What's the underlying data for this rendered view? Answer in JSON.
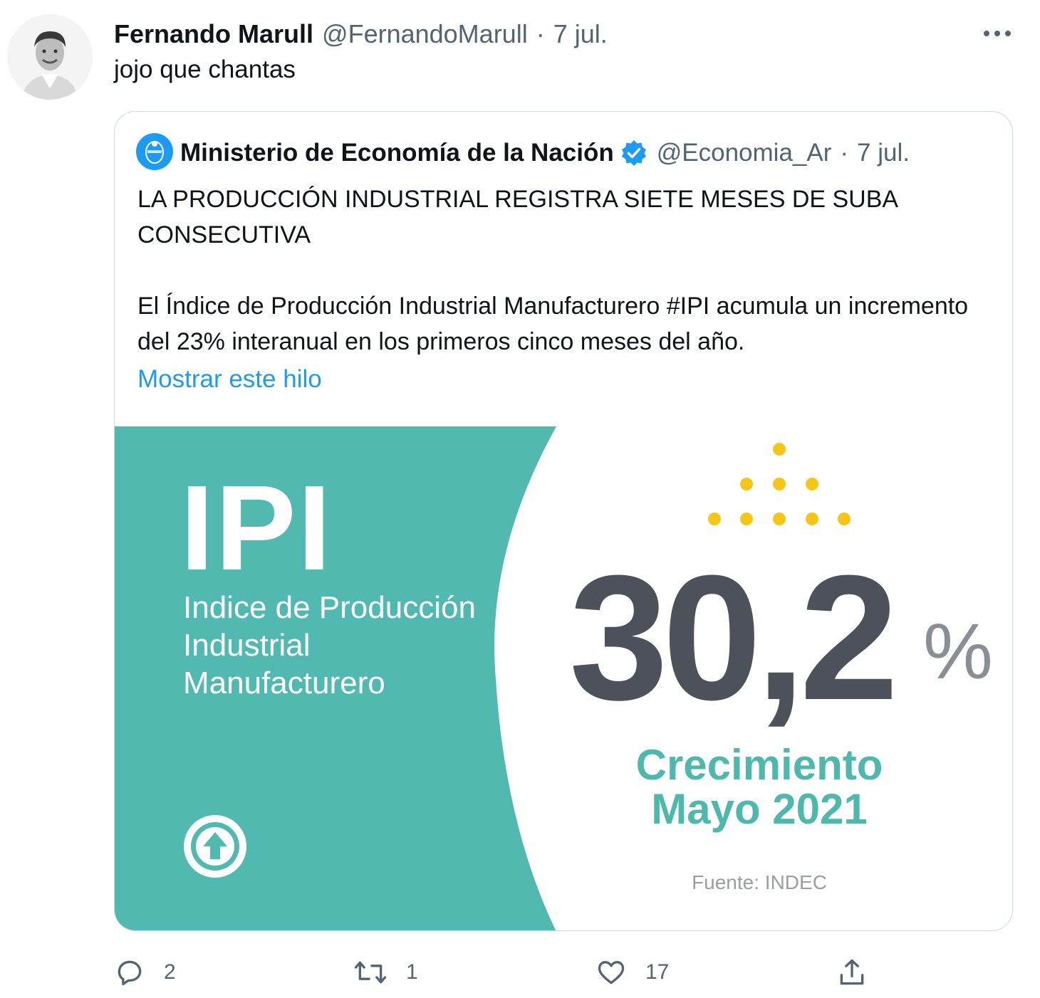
{
  "tweet": {
    "author_name": "Fernando Marull",
    "author_handle": "@FernandoMarull",
    "separator": "·",
    "date": "7 jul.",
    "text": "jojo que chantas",
    "more_label": "···"
  },
  "quoted": {
    "author_name": "Ministerio de Economía de la Nación",
    "author_handle": "@Economia_Ar",
    "separator": "·",
    "date": "7 jul.",
    "paragraph1": "LA PRODUCCIÓN INDUSTRIAL REGISTRA SIETE MESES DE SUBA CONSECUTIVA",
    "paragraph2": "El Índice de Producción Industrial Manufacturero #IPI acumula un incremento del 23% interanual en los primeros cinco meses del año.",
    "show_thread": "Mostrar este hilo",
    "image": {
      "title": "IPI",
      "subtitle_line1": "Indice de Producción",
      "subtitle_line2": "Industrial",
      "subtitle_line3": "Manufacturero",
      "value": "30,2",
      "unit": "%",
      "growth_line1": "Crecimiento",
      "growth_line2": "Mayo 2021",
      "source": "Fuente: INDEC",
      "colors": {
        "teal": "#52b9b0",
        "dark": "#4c515a",
        "yellow": "#f5c518",
        "growth": "#4db8ab"
      }
    }
  },
  "actions": {
    "reply_count": "2",
    "retweet_count": "1",
    "like_count": "17"
  }
}
